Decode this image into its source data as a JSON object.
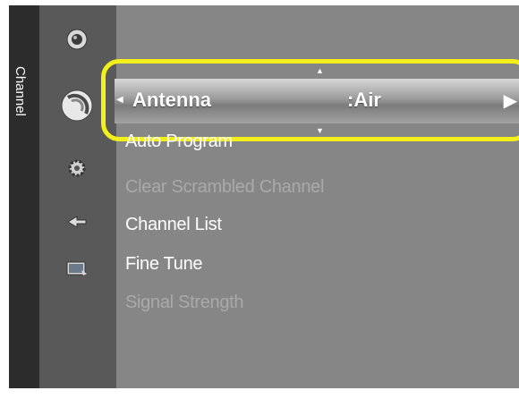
{
  "sidebar": {
    "category_label": "Channel",
    "icons": [
      "picture-icon",
      "channel-icon",
      "setup-icon",
      "input-icon",
      "application-icon"
    ]
  },
  "menu": {
    "selected": {
      "label": "Antenna",
      "value": ":Air",
      "arrow": "▶"
    },
    "items": [
      {
        "label": "Auto Program",
        "enabled": true
      },
      {
        "label": "Clear Scrambled Channel",
        "enabled": false
      },
      {
        "label": "Channel List",
        "enabled": true
      },
      {
        "label": "Fine Tune",
        "enabled": true
      },
      {
        "label": "Signal Strength",
        "enabled": false
      }
    ]
  },
  "colors": {
    "highlight": "#f2ef1a",
    "panel": "#868686",
    "iconbar": "#595959",
    "tab": "#2c2c2c",
    "disabled_text": "#a9a9a9"
  }
}
